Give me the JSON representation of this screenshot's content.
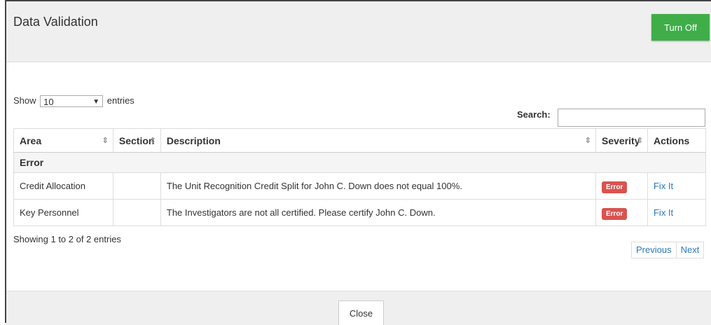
{
  "dialog": {
    "title": "Data Validation",
    "turn_off_label": "Turn Off",
    "close_label": "Close"
  },
  "length": {
    "show_label": "Show",
    "selected": "10",
    "entries_label": "entries"
  },
  "search": {
    "label": "Search:",
    "value": ""
  },
  "table": {
    "columns": [
      "Area",
      "Section",
      "Description",
      "Severity",
      "Actions"
    ],
    "group_label": "Error",
    "rows": [
      {
        "area": "Credit Allocation",
        "section": "",
        "description": "The Unit Recognition Credit Split for John C. Down does not equal 100%.",
        "severity": "Error",
        "action": "Fix It"
      },
      {
        "area": "Key Personnel",
        "section": "",
        "description": "The Investigators are not all certified. Please certify John C. Down.",
        "severity": "Error",
        "action": "Fix It"
      }
    ]
  },
  "info_text": "Showing 1 to 2 of 2 entries",
  "pagination": {
    "previous_label": "Previous",
    "next_label": "Next"
  },
  "colors": {
    "accent_button": "#3fae49",
    "error_badge": "#d9534f",
    "link": "#2a7ab8"
  },
  "icons": {
    "sort": "sort-icon",
    "dropdown": "chevron-down-icon"
  }
}
